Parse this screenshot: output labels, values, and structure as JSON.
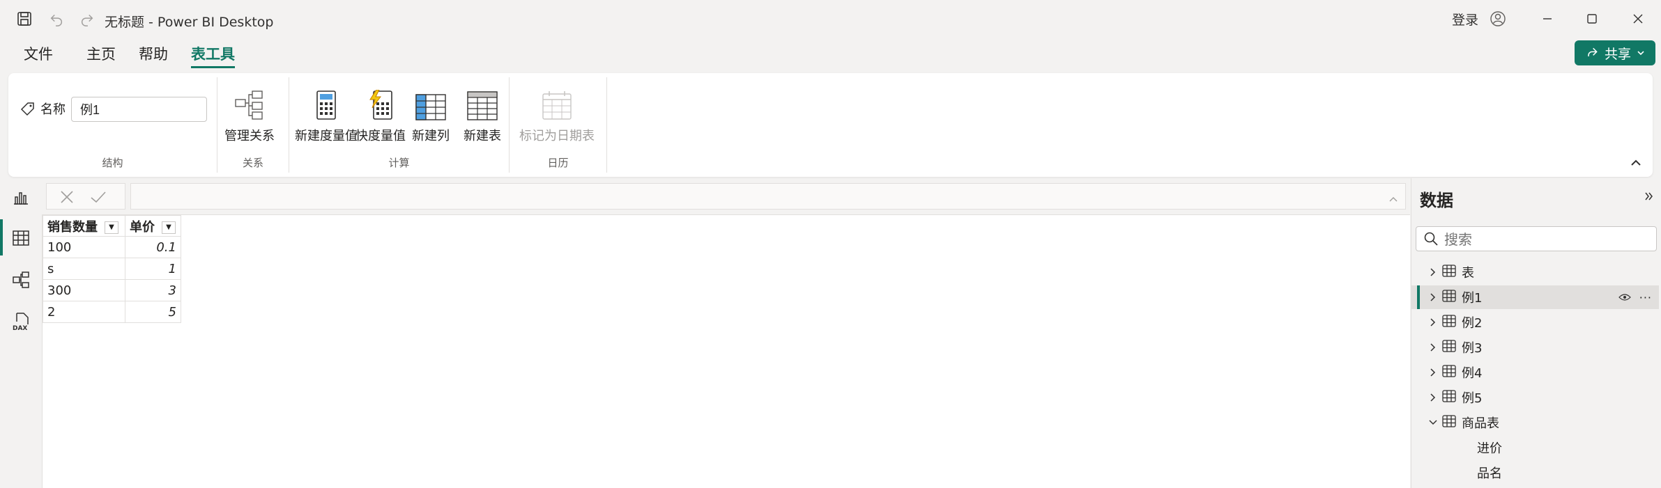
{
  "window": {
    "title": "无标题 - Power BI Desktop",
    "signin_label": "登录"
  },
  "menu": {
    "tabs": [
      {
        "label": "文件",
        "active": false
      },
      {
        "label": "主页",
        "active": false
      },
      {
        "label": "帮助",
        "active": false
      },
      {
        "label": "表工具",
        "active": true
      }
    ],
    "share_label": "共享"
  },
  "ribbon": {
    "groups": {
      "structure": {
        "label": "结构",
        "name_label": "名称",
        "name_value": "例1"
      },
      "relations": {
        "label": "关系",
        "manage_relations": "管理关系"
      },
      "calculations": {
        "label": "计算",
        "new_measure": "新建度量值",
        "quick_measure": "快度量值",
        "new_column": "新建列",
        "new_table": "新建表"
      },
      "calendar": {
        "label": "日历",
        "mark_date_table": "标记为日期表"
      }
    }
  },
  "table": {
    "columns": [
      "销售数量",
      "单价"
    ],
    "rows": [
      [
        "100",
        "0.1"
      ],
      [
        "s",
        "1"
      ],
      [
        "300",
        "3"
      ],
      [
        "2",
        "5"
      ]
    ]
  },
  "data_pane": {
    "title": "数据",
    "search_placeholder": "搜索",
    "items": [
      {
        "label": "表",
        "expanded": false,
        "selected": false
      },
      {
        "label": "例1",
        "expanded": false,
        "selected": true
      },
      {
        "label": "例2",
        "expanded": false,
        "selected": false
      },
      {
        "label": "例3",
        "expanded": false,
        "selected": false
      },
      {
        "label": "例4",
        "expanded": false,
        "selected": false
      },
      {
        "label": "例5",
        "expanded": false,
        "selected": false
      },
      {
        "label": "商品表",
        "expanded": true,
        "selected": false
      }
    ],
    "fields": [
      "进价",
      "品名"
    ]
  },
  "colors": {
    "accent": "#117865",
    "background": "#f3f2f1"
  }
}
